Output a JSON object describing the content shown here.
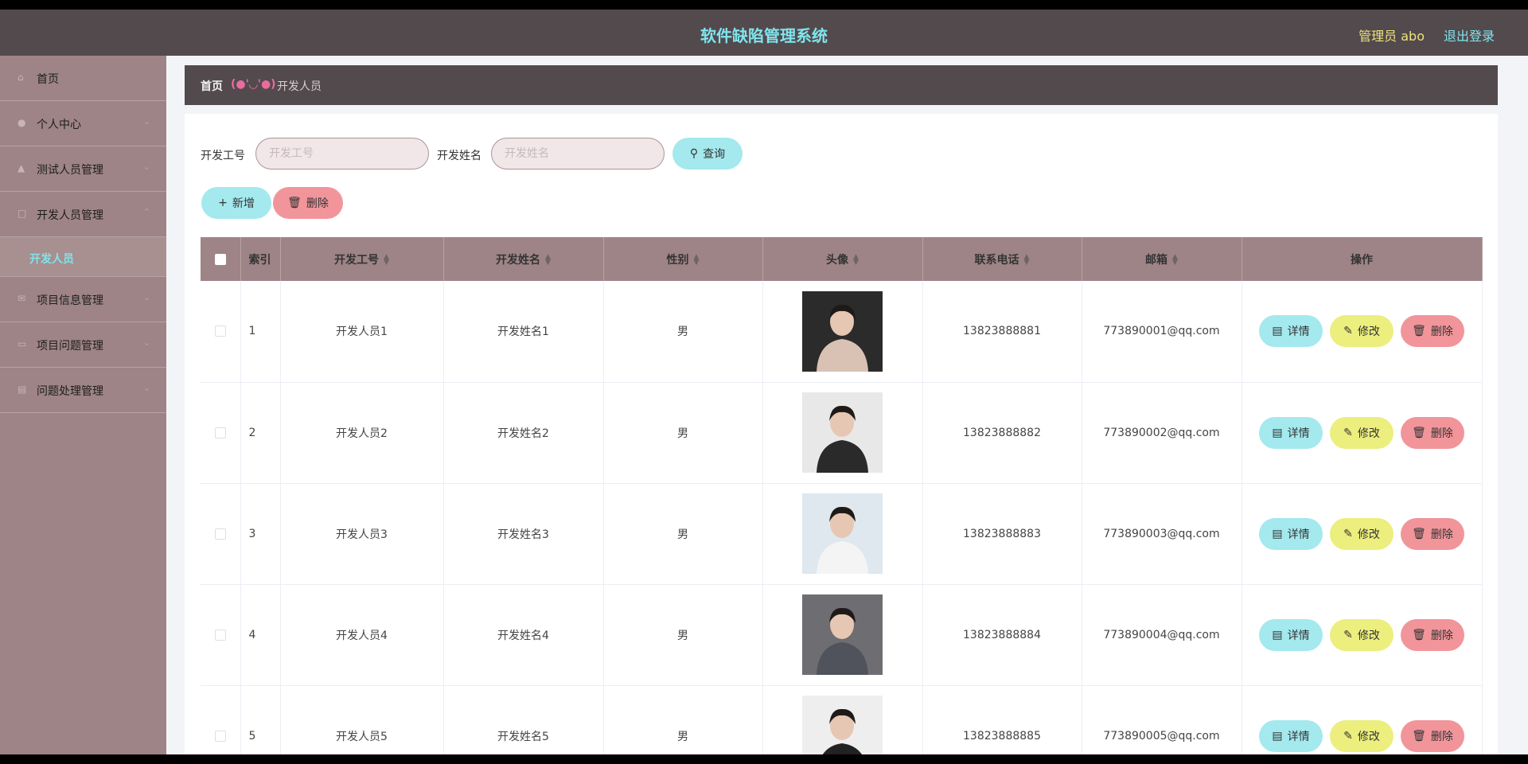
{
  "header": {
    "title": "软件缺陷管理系统",
    "user": "管理员 abo",
    "logout": "退出登录"
  },
  "sidebar": {
    "items": [
      {
        "label": "首页",
        "icon": "home-icon"
      },
      {
        "label": "个人中心",
        "icon": "user-icon"
      },
      {
        "label": "测试人员管理",
        "icon": "team-icon"
      },
      {
        "label": "开发人员管理",
        "icon": "developer-icon"
      }
    ],
    "active_sub": "开发人员",
    "items_after": [
      {
        "label": "项目信息管理",
        "icon": "mail-icon"
      },
      {
        "label": "项目问题管理",
        "icon": "question-icon"
      },
      {
        "label": "问题处理管理",
        "icon": "document-icon"
      }
    ]
  },
  "breadcrumb": {
    "home": "首页",
    "face": "(●'◡'●)",
    "current": "开发人员"
  },
  "search": {
    "label1": "开发工号",
    "placeholder1": "开发工号",
    "label2": "开发姓名",
    "placeholder2": "开发姓名",
    "query": "查询"
  },
  "toolbar": {
    "add": "新增",
    "delete": "删除"
  },
  "table": {
    "headers": [
      "索引",
      "开发工号",
      "开发姓名",
      "性别",
      "头像",
      "联系电话",
      "邮箱",
      "操作"
    ],
    "rows": [
      {
        "index": "1",
        "id": "开发人员1",
        "name": "开发姓名1",
        "gender": "男",
        "phone": "13823888881",
        "email": "773890001@qq.com"
      },
      {
        "index": "2",
        "id": "开发人员2",
        "name": "开发姓名2",
        "gender": "男",
        "phone": "13823888882",
        "email": "773890002@qq.com"
      },
      {
        "index": "3",
        "id": "开发人员3",
        "name": "开发姓名3",
        "gender": "男",
        "phone": "13823888883",
        "email": "773890003@qq.com"
      },
      {
        "index": "4",
        "id": "开发人员4",
        "name": "开发姓名4",
        "gender": "男",
        "phone": "13823888884",
        "email": "773890004@qq.com"
      },
      {
        "index": "5",
        "id": "开发人员5",
        "name": "开发姓名5",
        "gender": "男",
        "phone": "13823888885",
        "email": "773890005@qq.com"
      }
    ],
    "actions": {
      "detail": "详情",
      "edit": "修改",
      "delete": "删除"
    }
  },
  "colors": {
    "header_bg": "#534a4e",
    "sidebar_bg": "#9e8486",
    "accent_cyan": "#a3e9ee",
    "accent_red": "#f1959b",
    "accent_yellow": "#ecee7d"
  }
}
